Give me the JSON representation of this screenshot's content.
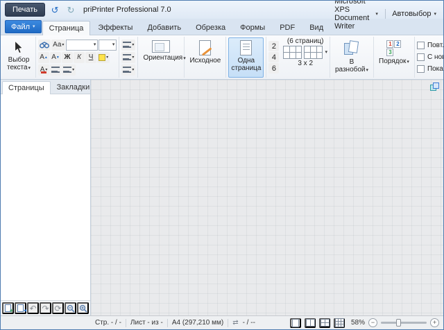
{
  "window": {
    "title": "priPrinter Professional 7.0"
  },
  "titlebar": {
    "print_button": "Печать"
  },
  "tabbar": {
    "file_button": "Файл",
    "tabs": [
      "Страница",
      "Эффекты",
      "Добавить",
      "Обрезка",
      "Формы",
      "PDF",
      "Вид"
    ],
    "active_tab": "Страница",
    "printer_dropdown": "Microsoft XPS Document Writer",
    "auto_dropdown": "Автовыбор"
  },
  "ribbon": {
    "text_select_label": "Выбор текста",
    "font": {
      "grow": "А",
      "shrink": "А",
      "bold": "Ж",
      "italic": "К",
      "underline": "Ч",
      "case": "Аа",
      "color": "А"
    },
    "font_name_value": "",
    "font_size_value": "",
    "orientation_label": "Ориентация",
    "original_label": "Исходное",
    "one_page_label": "Одна страница",
    "pages_numbers": [
      "2",
      "4",
      "6"
    ],
    "pages_header": "(6 страниц)",
    "pages_footer": "3 х 2",
    "shuffle_label": "В разнобой",
    "order_label": "Порядок",
    "order_digits": [
      "1",
      "2",
      "3"
    ],
    "checkboxes": [
      "Повт...",
      "С нов...",
      "Показ..."
    ]
  },
  "sidebar": {
    "tabs": [
      "Страницы",
      "Закладки"
    ],
    "active_tab": "Страницы"
  },
  "statusbar": {
    "page_info": "Стр. - / -",
    "sheet_info": "Лист - из -",
    "paper_info": "A4 (297,210 мм)",
    "position_info": "- / --",
    "zoom_percent": "58%"
  },
  "icons": {
    "dropdown": "▾",
    "qat_undo": "↺",
    "qat_redo": "↻",
    "undo": "↶",
    "redo": "↷",
    "refresh": "⟳",
    "swap": "⇄",
    "minus": "−",
    "plus": "+"
  },
  "colors": {
    "accent": "#2e7cd6",
    "selection_bg": "#cde3f8",
    "selection_border": "#7fb2e5"
  }
}
